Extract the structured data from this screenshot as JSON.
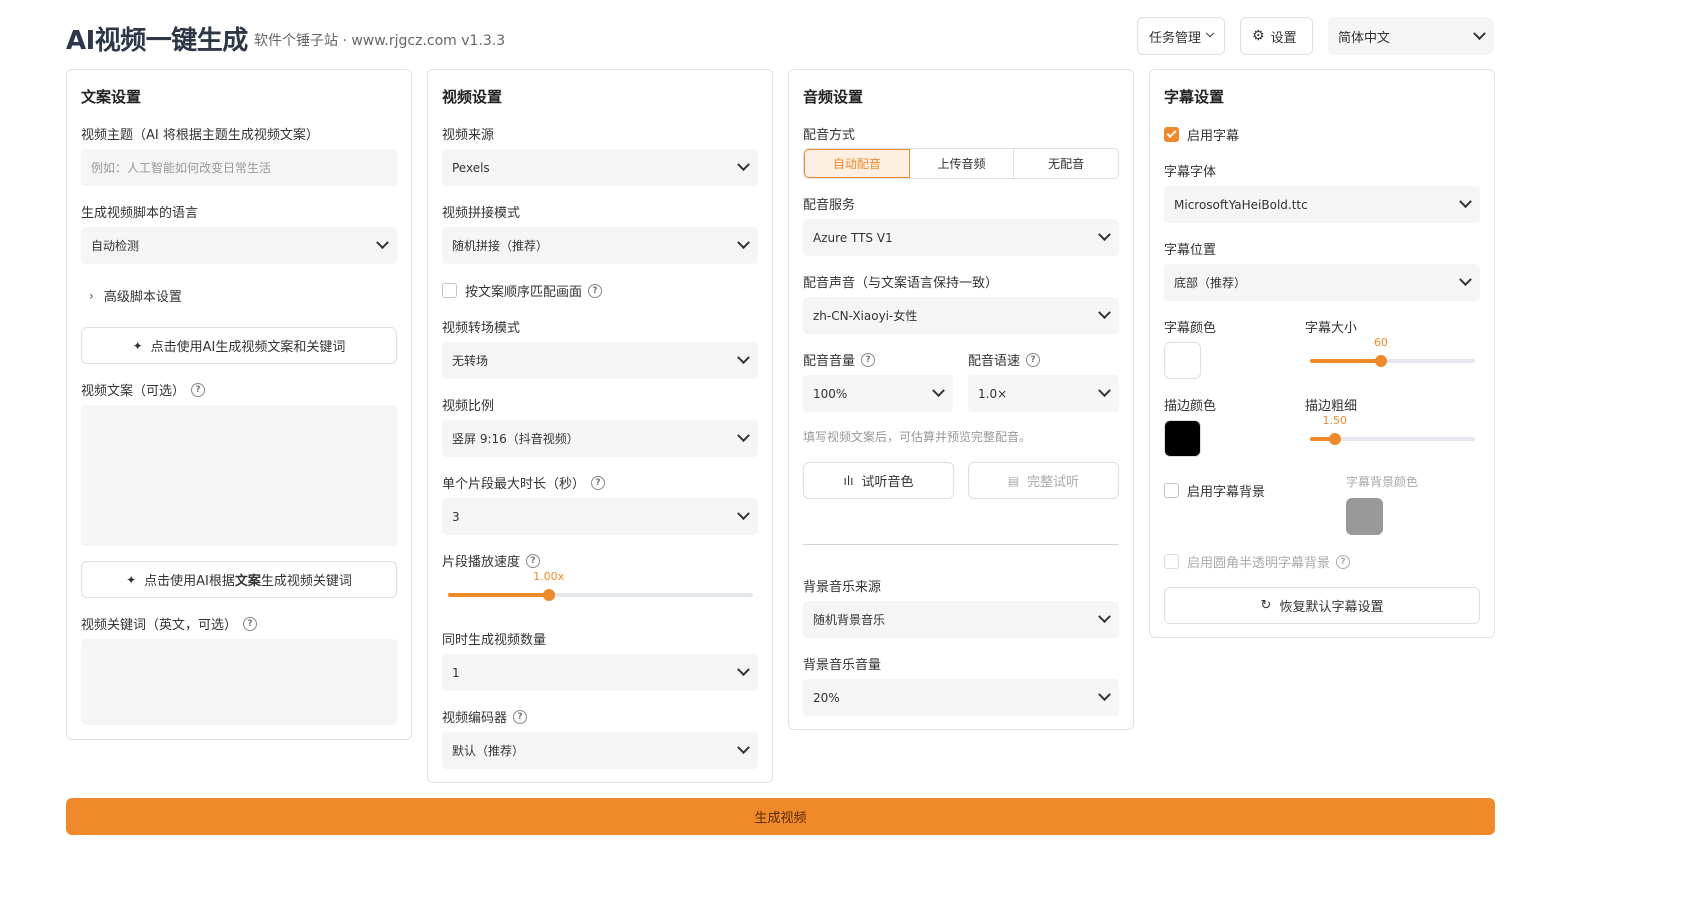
{
  "header": {
    "title": "AI视频一键生成",
    "subtitle": "软件个锤子站 · www.rjgcz.com   v1.3.3",
    "task_manage": "任务管理",
    "settings": "设置",
    "language": "简体中文"
  },
  "script_panel": {
    "title": "文案设置",
    "topic_label": "视频主题（AI 将根据主题生成视频文案）",
    "topic_placeholder": "例如：人工智能如何改变日常生活",
    "lang_label": "生成视频脚本的语言",
    "lang_value": "自动检测",
    "advanced": "高级脚本设置",
    "gen_script_btn": "点击使用AI生成视频文案和关键词",
    "script_label": "视频文案（可选）",
    "gen_keywords_btn_pre": "点击使用AI根据",
    "gen_keywords_btn_bold": "文案",
    "gen_keywords_btn_post": "生成视频关键词",
    "keywords_label": "视频关键词（英文，可选）"
  },
  "video_panel": {
    "title": "视频设置",
    "source_label": "视频来源",
    "source_value": "Pexels",
    "concat_label": "视频拼接模式",
    "concat_value": "随机拼接（推荐）",
    "match_order": "按文案顺序匹配画面",
    "transition_label": "视频转场模式",
    "transition_value": "无转场",
    "ratio_label": "视频比例",
    "ratio_value": "竖屏 9:16（抖音视频）",
    "clip_max_label": "单个片段最大时长（秒）",
    "clip_max_value": "3",
    "speed_label": "片段播放速度",
    "speed_display": "1.00x",
    "speed_fraction": 0.33,
    "count_label": "同时生成视频数量",
    "count_value": "1",
    "codec_label": "视频编码器",
    "codec_value": "默认（推荐）"
  },
  "audio_panel": {
    "title": "音频设置",
    "dub_mode_label": "配音方式",
    "dub_modes": [
      "自动配音",
      "上传音频",
      "无配音"
    ],
    "dub_service_label": "配音服务",
    "dub_service_value": "Azure TTS V1",
    "voice_label": "配音声音（与文案语言保持一致）",
    "voice_value": "zh-CN-Xiaoyi-女性",
    "volume_label": "配音音量",
    "volume_value": "100%",
    "rate_label": "配音语速",
    "rate_value": "1.0×",
    "hint": "填写视频文案后，可估算并预览完整配音。",
    "preview_voice_btn": "试听音色",
    "full_preview_btn": "完整试听",
    "bgm_source_label": "背景音乐来源",
    "bgm_source_value": "随机背景音乐",
    "bgm_volume_label": "背景音乐音量",
    "bgm_volume_value": "20%"
  },
  "subtitle_panel": {
    "title": "字幕设置",
    "enable": "启用字幕",
    "font_label": "字幕字体",
    "font_value": "MicrosoftYaHeiBold.ttc",
    "position_label": "字幕位置",
    "position_value": "底部（推荐）",
    "color_label": "字幕颜色",
    "size_label": "字幕大小",
    "size_value": "60",
    "size_fraction": 0.43,
    "stroke_color_label": "描边颜色",
    "stroke_width_label": "描边粗细",
    "stroke_width_value": "1.50",
    "stroke_fraction": 0.15,
    "enable_bg": "启用字幕背景",
    "bg_color_label": "字幕背景颜色",
    "rounded_bg": "启用圆角半透明字幕背景",
    "reset_btn": "恢复默认字幕设置",
    "colors": {
      "subtitle": "#ffffff",
      "stroke": "#000000",
      "bg": "#999999"
    }
  },
  "generate_btn": "生成视频",
  "accent_color": "#f0892a"
}
